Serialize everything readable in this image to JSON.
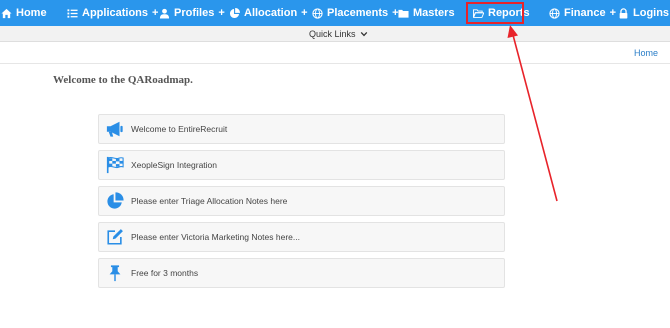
{
  "nav": {
    "home": "Home",
    "applications": "Applications",
    "profiles": "Profiles",
    "allocation": "Allocation",
    "placements": "Placements",
    "masters": "Masters",
    "reports": "Reports",
    "finance": "Finance",
    "logins": "Logins",
    "plus": "+"
  },
  "quick_links": "Quick Links",
  "breadcrumb_home": "Home",
  "welcome": "Welcome to the QARoadmap.",
  "panels": [
    {
      "label": "Welcome to EntireRecruit",
      "icon": "megaphone-icon"
    },
    {
      "label": "XeopleSign Integration",
      "icon": "checkered-flag-icon"
    },
    {
      "label": "Please enter Triage Allocation Notes here",
      "icon": "pie-chart-icon"
    },
    {
      "label": "Please enter Victoria Marketing Notes here...",
      "icon": "edit-icon"
    },
    {
      "label": "Free for 3 months",
      "icon": "thumbtack-icon"
    }
  ],
  "colors": {
    "nav_bg": "#2a96ec",
    "icon_blue": "#2a8ee6",
    "annotation_red": "#e8232a"
  }
}
